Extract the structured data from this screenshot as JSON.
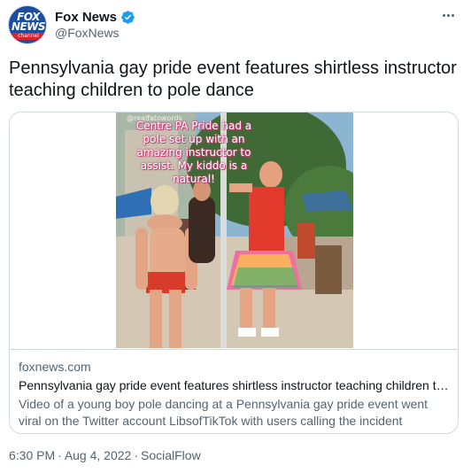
{
  "author": {
    "display_name": "Fox News",
    "handle": "@FoxNews",
    "avatar_logo": {
      "line1": "FOX",
      "line2": "NEWS",
      "line3": "channel"
    },
    "verified_icon": "verified-badge-icon"
  },
  "tweet": {
    "text": "Pennsylvania gay pride event features shirtless instructor teaching children to pole dance"
  },
  "card": {
    "image_caption": "Centre PA Pride had a pole set up with an amazing instructor to assist. My kiddo is a natural!",
    "image_watermark": "@realfatowords",
    "domain": "foxnews.com",
    "title": "Pennsylvania gay pride event features shirtless instructor teaching children to p...",
    "description": "Video of a young boy pole dancing at a Pennsylvania gay pride event went viral on the Twitter account LibsofTikTok with users calling the incident inappropriate."
  },
  "footer": {
    "time": "6:30 PM",
    "date": "Aug 4, 2022",
    "source": "SocialFlow",
    "separator": "·"
  },
  "colors": {
    "text_primary": "#0f1419",
    "text_secondary": "#536471",
    "border": "#cfd9de",
    "verified": "#1d9bf0",
    "fox_blue": "#1a4ea0",
    "fox_red": "#d8232a"
  },
  "icons": {
    "more": "more-options-icon",
    "verified": "verified-badge-icon"
  }
}
